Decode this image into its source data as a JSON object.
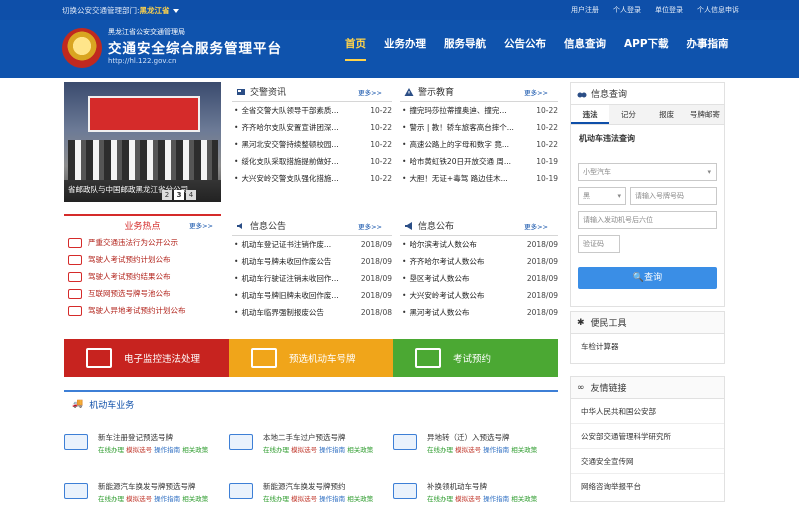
{
  "topbar": {
    "switch_label": "切换公安交通管理部门:",
    "region": "黑龙江省",
    "links": [
      "用户注册",
      "个人登录",
      "单位登录",
      "个人信息申诉"
    ]
  },
  "header": {
    "org": "黑龙江省公安交通管理局",
    "title": "交通安全综合服务管理平台",
    "url": "http://hl.122.gov.cn"
  },
  "nav": [
    "首页",
    "业务办理",
    "服务导航",
    "公告公布",
    "信息查询",
    "APP下载",
    "办事指南"
  ],
  "slide": {
    "caption": "省邮政队与中国邮政黑龙江省分公司...",
    "pages": [
      "2",
      "3",
      "4"
    ],
    "active": "3"
  },
  "news": {
    "title": "交警资讯",
    "more": "更多>>",
    "items": [
      {
        "text": "全省交警大队领导干部素质...",
        "date": "10-22"
      },
      {
        "text": "齐齐哈尔支队安置宣讲团深...",
        "date": "10-22"
      },
      {
        "text": "黑河北安交警持续整顿校园...",
        "date": "10-22"
      },
      {
        "text": "绥化支队采取措施提前做好...",
        "date": "10-22"
      },
      {
        "text": "大兴安岭交警支队强化措施...",
        "date": "10-22"
      }
    ]
  },
  "warning": {
    "title": "警示教育",
    "more": "更多>>",
    "items": [
      {
        "text": "撞完玛莎拉蒂撞奥迪、撞完...",
        "date": "10-22"
      },
      {
        "text": "警示 | 教！轿车旅客高台摔个...",
        "date": "10-22"
      },
      {
        "text": "高速公路上的字母和数字 竟...",
        "date": "10-22"
      },
      {
        "text": "哈市黄虹铁20日开放交通 周...",
        "date": "10-19"
      },
      {
        "text": "大胆！无证+毒驾 路边佳木...",
        "date": "10-19"
      }
    ]
  },
  "hot": {
    "title": "业务热点",
    "more": "更多>>",
    "items": [
      "严重交通违法行为公开公示",
      "驾驶人考试预约计划公布",
      "驾驶人考试预约结果公布",
      "互联网预选号牌号池公布",
      "驾驶人异地考试预约计划公布"
    ]
  },
  "notice": {
    "title": "信息公告",
    "more": "更多>>",
    "items": [
      {
        "text": "机动车登记证书注销作废...",
        "date": "2018/09"
      },
      {
        "text": "机动车号牌未收回作废公告",
        "date": "2018/09"
      },
      {
        "text": "机动车行驶证注销未收回作...",
        "date": "2018/09"
      },
      {
        "text": "机动车号牌旧牌未收回作废...",
        "date": "2018/09"
      },
      {
        "text": "机动车临界强制报废公告",
        "date": "2018/08"
      }
    ]
  },
  "publish": {
    "title": "信息公布",
    "more": "更多>>",
    "items": [
      {
        "text": "哈尔滨考试人数公布",
        "date": "2018/09"
      },
      {
        "text": "齐齐哈尔考试人数公布",
        "date": "2018/09"
      },
      {
        "text": "垦区考试人数公布",
        "date": "2018/09"
      },
      {
        "text": "大兴安岭考试人数公布",
        "date": "2018/09"
      },
      {
        "text": "黑河考试人数公布",
        "date": "2018/09"
      }
    ]
  },
  "services": [
    {
      "label": "电子监控违法处理",
      "color": "#c7231f"
    },
    {
      "label": "预选机动车号牌",
      "color": "#f0a51a"
    },
    {
      "label": "考试预约",
      "color": "#4ba833"
    }
  ],
  "query": {
    "title": "信息查询",
    "tabs": [
      "违法",
      "记分",
      "报废",
      "号牌邮寄"
    ],
    "subtitle": "机动车违法查询",
    "vehicle_type": "小型汽车",
    "province": "黑",
    "plate_placeholder": "请输入号牌号码",
    "engine_placeholder": "请输入发动机号后六位",
    "captcha_placeholder": "验证码",
    "button": "查询"
  },
  "tools": {
    "title": "便民工具",
    "items": [
      "车检计算器"
    ]
  },
  "links": {
    "title": "友情链接",
    "items": [
      "中华人民共和国公安部",
      "公安部交通管理科学研究所",
      "交通安全宣传网",
      "网络咨询举报平台"
    ]
  },
  "vehicle": {
    "title": "机动车业务",
    "actions": [
      "在线办理",
      "模拟选号",
      "操作指南",
      "相关政策"
    ],
    "items": [
      "新车注册登记预选号牌",
      "本地二手车过户预选号牌",
      "异地转（迁）入预选号牌",
      "新能源汽车换发号牌预选号牌",
      "新能源汽车换发号牌预约",
      "补换领机动车号牌"
    ]
  }
}
